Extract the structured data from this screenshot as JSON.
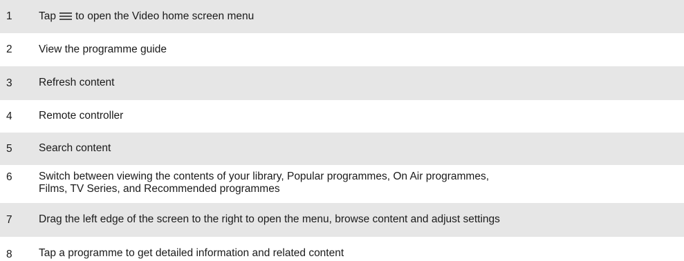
{
  "legend": {
    "items": [
      {
        "number": "1",
        "text_before": "Tap",
        "icon": "menu-icon",
        "text_after": "to open the Video home screen menu"
      },
      {
        "number": "2",
        "text": "View the programme guide"
      },
      {
        "number": "3",
        "text": "Refresh content"
      },
      {
        "number": "4",
        "text": "Remote controller"
      },
      {
        "number": "5",
        "text": "Search content"
      },
      {
        "number": "6",
        "line1": "Switch between viewing the contents of your library, Popular programmes, On Air programmes,",
        "line2": "Films, TV Series, and Recommended programmes"
      },
      {
        "number": "7",
        "text": "Drag the left edge of the screen to the right to open the menu, browse content and adjust settings"
      },
      {
        "number": "8",
        "text": "Tap a programme to get detailed information and related content"
      }
    ],
    "colors": {
      "shaded_row": "#e6e6e6",
      "text": "#1a1a1a"
    }
  }
}
